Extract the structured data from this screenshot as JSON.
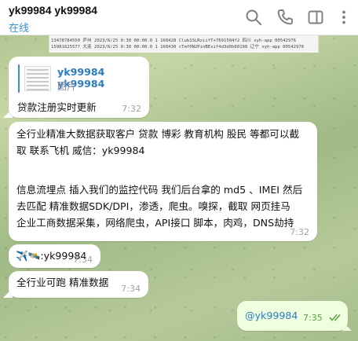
{
  "header": {
    "title": "yk99984 yk99984",
    "status": "在线",
    "icons": [
      "search-icon",
      "phone-icon",
      "sidebar-icon",
      "more-icon"
    ]
  },
  "spreadsheet_rows": [
    "13478784550 庐州   2023/8/25 0:30  00:00.0  1  168428 Club1SLRxiifT+7691504f2 四川   xyh-app  00542976",
    "15981625577 大连   2023/8/25 0:30  00:00.0  1  168430 cTmf0N2PinBEsif4d3d0b60198 辽宁  xyh-app  00542976"
  ],
  "messages": [
    {
      "reply": {
        "name": "yk99984 yk99984",
        "sub": "图片"
      },
      "text": "贷款注册实时更新",
      "time": "7:32"
    },
    {
      "lines": [
        "全行业精准大数据获取客户 贷款 博彩 教育机构 股民 等都可以截",
        "取 联系飞机 威信：yk99984",
        "",
        "",
        "信息流埋点 插入我们的监控代码 我们后台拿的 md5 、IMEI 然后",
        "去匹配 精准数据SDK/DPI，渗透，爬虫。嗅探，截取 网页挂马",
        "企业工商数据采集，网络爬虫，API接口 脚本，肉鸡，DNS劫持"
      ],
      "time": "7:32"
    },
    {
      "emoji": "✈️🛰️",
      "text": ":yk99984",
      "time": "7:34"
    },
    {
      "text": "全行业可跑 精准数据",
      "time": "7:34"
    }
  ],
  "outgoing": {
    "text": "@yk99984",
    "time": "7:35"
  }
}
